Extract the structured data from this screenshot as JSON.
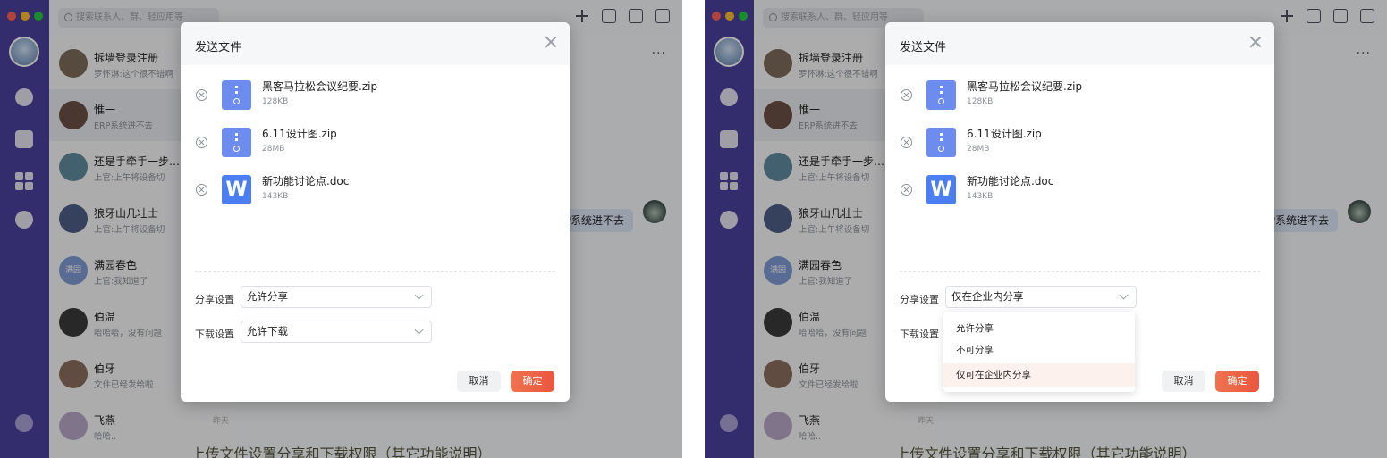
{
  "search": {
    "placeholder": "搜索联系人、群、轻应用等"
  },
  "icons": {
    "window_dots": [
      "#ff5f57",
      "#febc2e",
      "#28c840"
    ],
    "sidebar": [
      "chat-icon",
      "doc-icon",
      "apps-icon",
      "w-icon",
      "gear-icon"
    ],
    "toolbar": [
      "plus-icon",
      "folder-icon",
      "message-icon",
      "card-icon"
    ]
  },
  "conversations": [
    {
      "name": "拆墙登录注册",
      "msg": "罗怀淋:这个很不错啊",
      "time": "",
      "color": "#7d6a5a"
    },
    {
      "name": "惟一",
      "msg": "ERP系统进不去",
      "time": "",
      "color": "#6b4f44",
      "active": true
    },
    {
      "name": "还是手牵手一步…",
      "msg": "上官:上午将设备切",
      "time": "",
      "color": "#5f8a9e"
    },
    {
      "name": "狼牙山几壮士",
      "msg": "上官:上午将设备切",
      "time": "",
      "color": "#4d5d86"
    },
    {
      "name": "满园春色",
      "msg": "上官:我知道了",
      "time": "",
      "color": "#7f9ad3",
      "initials": "满园"
    },
    {
      "name": "伯温",
      "msg": "哈哈哈，没有问题",
      "time": "",
      "color": "#3a3a3a"
    },
    {
      "name": "伯牙",
      "msg": "文件已经发给啦",
      "time": "",
      "color": "#8a6e5c"
    },
    {
      "name": "飞燕",
      "msg": "哈哈..",
      "time": "昨天",
      "color": "#b8a6c8"
    }
  ],
  "chat": {
    "more": "···",
    "bubble": "ERP系统进不去"
  },
  "dialog": {
    "title": "发送文件",
    "files": [
      {
        "name": "黑客马拉松会议纪要.zip",
        "size": "128KB",
        "type": "zip"
      },
      {
        "name": "6.11设计图.zip",
        "size": "28MB",
        "type": "zip"
      },
      {
        "name": "新功能讨论点.doc",
        "size": "143KB",
        "type": "doc"
      }
    ],
    "share_label": "分享设置",
    "download_label": "下载设置",
    "cancel": "取消",
    "ok": "确定"
  },
  "left_state": {
    "share_value": "允许分享",
    "download_value": "允许下载"
  },
  "right_state": {
    "share_value": "仅在企业内分享",
    "download_value": ""
  },
  "dropdown": {
    "options": [
      "允许分享",
      "不可分享",
      "仅可在企业内分享"
    ],
    "selected_index": 2
  },
  "caption": "上传文件设置分享和下载权限（其它功能说明）"
}
